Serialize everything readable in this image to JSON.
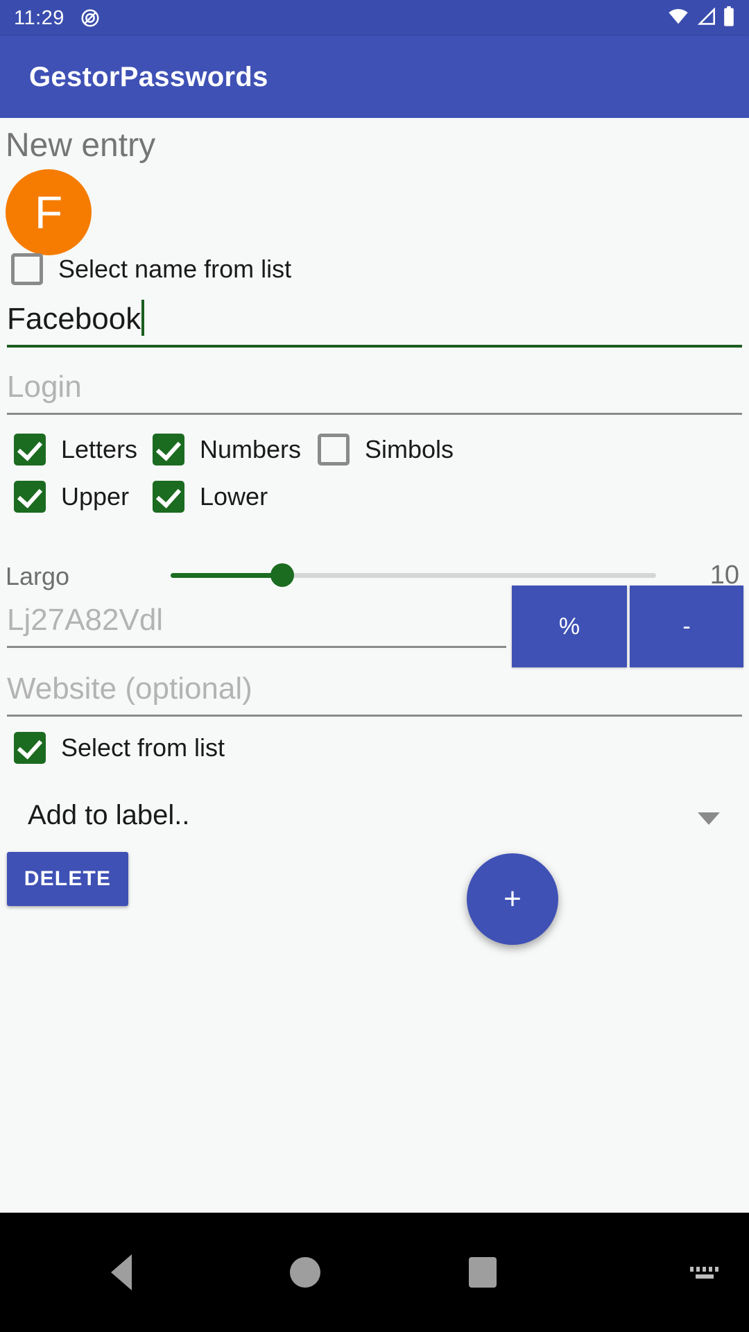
{
  "statusbar": {
    "time": "11:29",
    "notification_icon": "circle-slash-icon",
    "wifi_icon": "wifi-icon",
    "signal_icon": "signal-icon",
    "battery_icon": "battery-full-icon"
  },
  "appbar": {
    "title": "GestorPasswords"
  },
  "screen": {
    "title": "New entry",
    "avatar_letter": "F",
    "avatar_color": "#F57C00"
  },
  "select_name": {
    "label": "Select name from list",
    "checked": false
  },
  "name_field": {
    "value": "Facebook",
    "focused": true,
    "underline_color": "#1B5E20"
  },
  "login_field": {
    "placeholder": "Login",
    "value": "",
    "underline_color": "#8A8A8A"
  },
  "options": {
    "row1": [
      {
        "label": "Letters",
        "checked": true
      },
      {
        "label": "Numbers",
        "checked": true
      },
      {
        "label": "Simbols",
        "checked": false
      }
    ],
    "row2": [
      {
        "label": "Upper",
        "checked": true
      },
      {
        "label": "Lower",
        "checked": true
      }
    ]
  },
  "length_slider": {
    "label": "Largo",
    "value": "10",
    "percent": 23,
    "accent_color": "#1B6B20"
  },
  "password_field": {
    "placeholder": "Lj27A82Vdl",
    "value": ""
  },
  "generate_buttons": {
    "percent_label": "%",
    "minus_label": "-"
  },
  "website_field": {
    "placeholder": "Website (optional)",
    "value": ""
  },
  "select_from_list": {
    "label": "Select from list",
    "checked": true
  },
  "label_spinner": {
    "selected": "Add to label..",
    "arrow_icon": "chevron-down-icon"
  },
  "delete_button": {
    "label": "DELETE"
  },
  "fab": {
    "label": "+",
    "icon": "plus-icon"
  },
  "navbar": {
    "back_icon": "back-triangle-icon",
    "home_icon": "home-circle-icon",
    "recents_icon": "recents-square-icon",
    "keyboard_icon": "keyboard-icon"
  },
  "colors": {
    "statusbar": "#3A4DAE",
    "appbar": "#3F51B5",
    "accent_green": "#1B6B20",
    "accent_blue": "#3F51B5"
  }
}
